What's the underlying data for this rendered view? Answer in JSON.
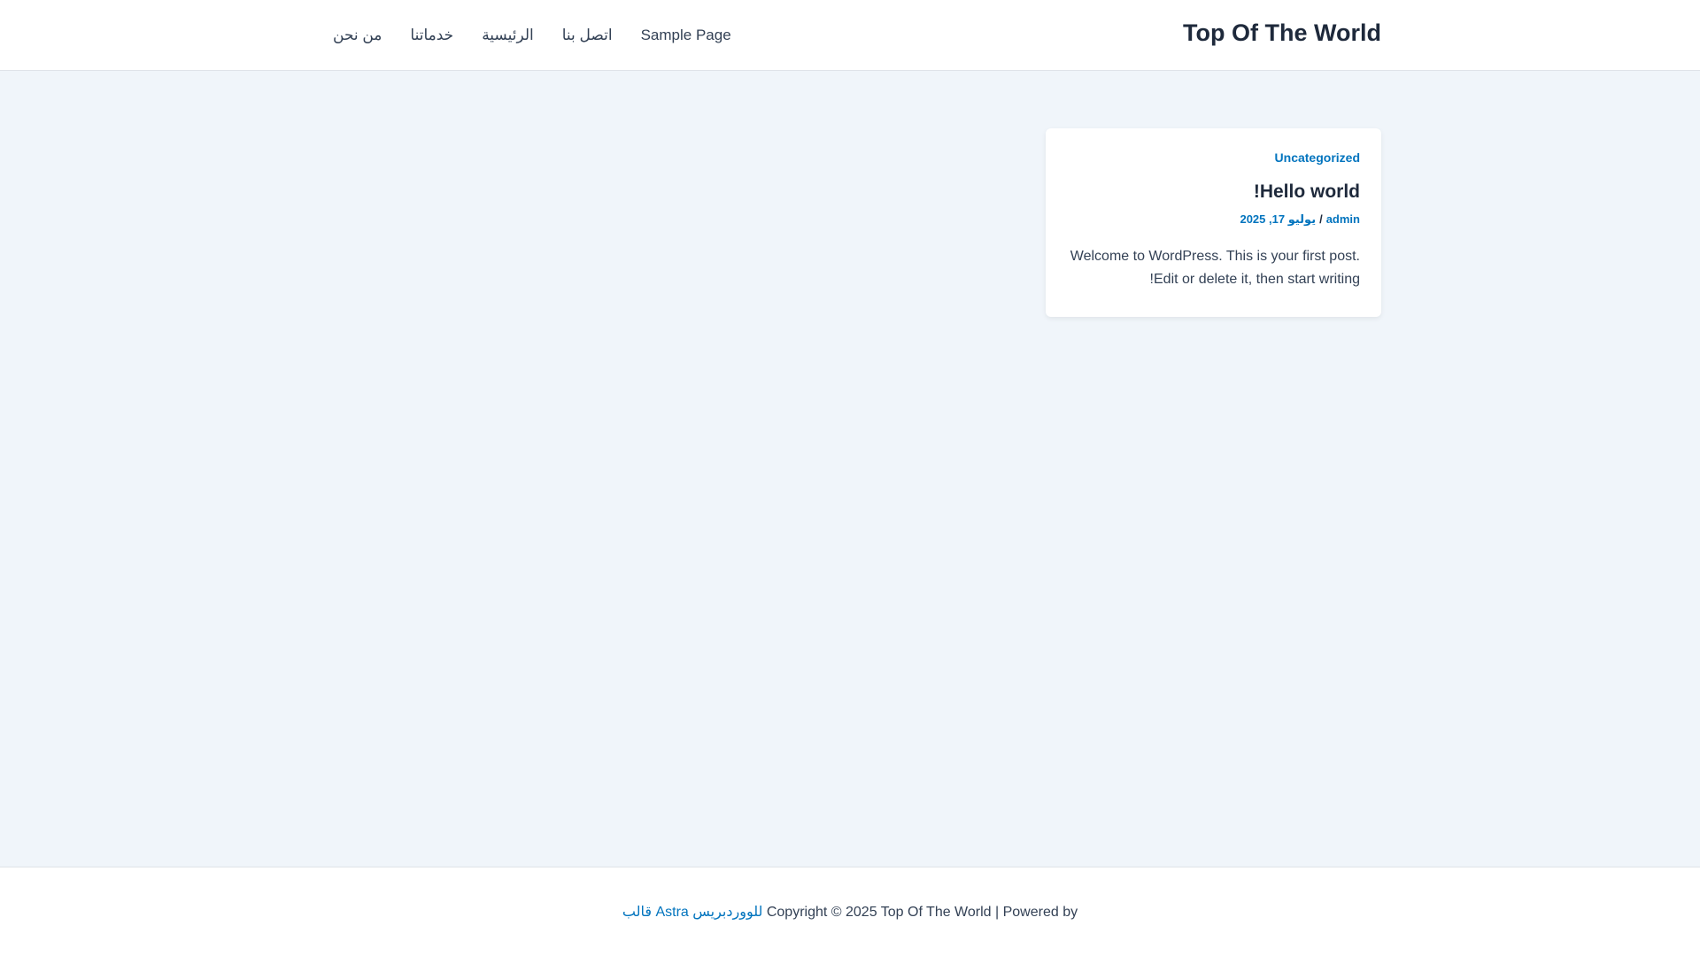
{
  "header": {
    "site_title": "Top Of The World",
    "nav": [
      {
        "label": "Sample Page"
      },
      {
        "label": "اتصل بنا"
      },
      {
        "label": "الرئيسية"
      },
      {
        "label": "خدماتنا"
      },
      {
        "label": "من نحن"
      }
    ]
  },
  "post": {
    "category": "Uncategorized",
    "title": "Hello world!",
    "author": "admin",
    "separator": "/",
    "date": "يوليو 17, 2025",
    "excerpt": "Welcome to WordPress. This is your first post. Edit or delete it, then start writing!"
  },
  "footer": {
    "theme_link": "قالب Astra للووردبريس",
    "copyright": "Copyright © 2025 Top Of The World | Powered by"
  },
  "colors": {
    "accent": "#0274be",
    "heading": "#1e293b",
    "background": "#f0f5fa"
  }
}
